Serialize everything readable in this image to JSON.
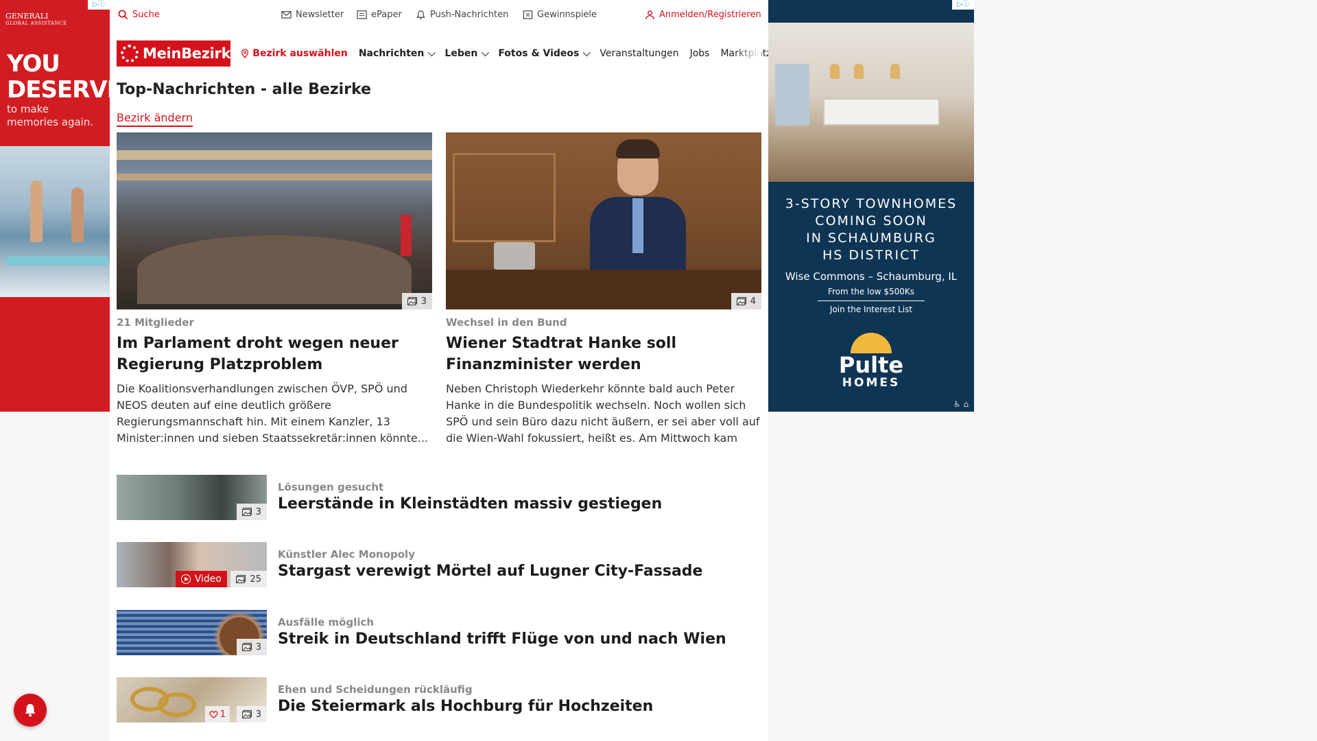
{
  "ads": {
    "left": {
      "brand": "GENERALI",
      "brand_sub": "GLOBAL ASSISTANCE",
      "headline_1": "YOU",
      "headline_2": "DESERVE",
      "sub_1": "to make",
      "sub_2": "memories again."
    },
    "right": {
      "line_1": "3-STORY TOWNHOMES",
      "line_2": "COMING SOON",
      "line_3": "IN SCHAUMBURG",
      "line_4": "HS DISTRICT",
      "location": "Wise Commons – Schaumburg, IL",
      "price": "From the low $500Ks",
      "cta": "Join the Interest List",
      "logo_name": "Pulte",
      "logo_sub": "HOMES"
    }
  },
  "utility": {
    "search": "Suche",
    "newsletter": "Newsletter",
    "epaper": "ePaper",
    "push": "Push-Nachrichten",
    "games": "Gewinnspiele",
    "login": "Anmelden/Registrieren"
  },
  "nav": {
    "logo": "MeinBezirk",
    "district": "Bezirk auswählen",
    "items": [
      {
        "label": "Nachrichten",
        "dropdown": true
      },
      {
        "label": "Leben",
        "dropdown": true
      },
      {
        "label": "Fotos & Videos",
        "dropdown": true
      },
      {
        "label": "Veranstaltungen",
        "dropdown": false
      },
      {
        "label": "Jobs",
        "dropdown": false
      },
      {
        "label": "Marktplatz",
        "dropdown": false
      }
    ]
  },
  "section": {
    "title": "Top-Nachrichten - alle Bezirke",
    "change_link": "Bezirk ändern"
  },
  "top_articles": [
    {
      "kicker": "21 Mitglieder",
      "headline": "Im Parlament droht wegen neuer Regierung Platzproblem",
      "teaser": "Die Koalitionsverhandlungen zwischen ÖVP, SPÖ und NEOS deuten auf eine deutlich größere Regierungsmannschaft hin. Mit einem Kanzler, 13 Minister:innen und sieben Staatssekretär:innen könnte...",
      "photo_count": "3"
    },
    {
      "kicker": "Wechsel in den Bund",
      "headline": "Wiener Stadtrat Hanke soll Finanzminister werden",
      "teaser": "Neben Christoph Wiederkehr könnte bald auch Peter Hanke in die Bundespolitik wechseln. Noch wollen sich SPÖ und sein Büro dazu nicht äußern, er sei aber voll auf die Wien-Wahl fokussiert, heißt es. Am Mittwoch kam es...",
      "photo_count": "4"
    }
  ],
  "list_articles": [
    {
      "kicker": "Lösungen gesucht",
      "headline": "Leerstände in Kleinstädten massiv gestiegen",
      "photo_count": "3"
    },
    {
      "kicker": "Künstler Alec Monopoly",
      "headline": "Stargast verewigt Mörtel auf Lugner City-Fassade",
      "photo_count": "25",
      "video_label": "Video"
    },
    {
      "kicker": "Ausfälle möglich",
      "headline": "Streik in Deutschland trifft Flüge von und nach Wien",
      "photo_count": "3"
    },
    {
      "kicker": "Ehen und Scheidungen rückläufig",
      "headline": "Die Steiermark als Hochburg für Hochzeiten",
      "photo_count": "3",
      "likes": "1"
    }
  ],
  "colors": {
    "brand_red": "#d4121b",
    "ad_navy": "#0f3554",
    "kicker_gray": "#888888"
  }
}
